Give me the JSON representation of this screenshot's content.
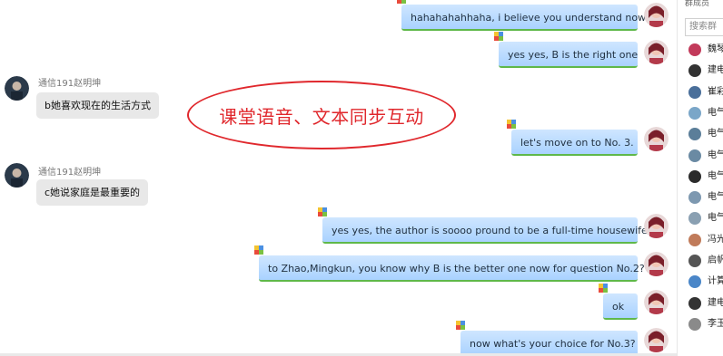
{
  "chat": {
    "annotation": "课堂语音、文本同步互动",
    "messages": [
      {
        "dir": "out",
        "text": "hahahahahhaha, i believe you understand now"
      },
      {
        "dir": "out",
        "text": "yes yes, B is the right one"
      },
      {
        "dir": "in",
        "sender": "通信191赵明坤",
        "text": "b她喜欢现在的生活方式"
      },
      {
        "dir": "out",
        "text": "let's move on to No. 3."
      },
      {
        "dir": "in",
        "sender": "通信191赵明坤",
        "text": "c她说家庭是最重要的"
      },
      {
        "dir": "out",
        "text": "yes yes, the author is soooo pround to be a full-time housewife"
      },
      {
        "dir": "out",
        "text": "to Zhao,Mingkun, you know why B is the better one now for question No.2?"
      },
      {
        "dir": "out",
        "text": "ok"
      },
      {
        "dir": "out",
        "text": "now what's your choice for No.3?"
      }
    ]
  },
  "sidebar": {
    "title": "群成员",
    "search_placeholder": "搜索群",
    "members": [
      {
        "name": "魏琴",
        "color": "#c23a5a"
      },
      {
        "name": "建电",
        "color": "#333333"
      },
      {
        "name": "崔彩",
        "color": "#4a6f9a"
      },
      {
        "name": "电气",
        "color": "#7aa6c8"
      },
      {
        "name": "电气",
        "color": "#5b7e99"
      },
      {
        "name": "电气",
        "color": "#6a8aa3"
      },
      {
        "name": "电气",
        "color": "#2b2b2b"
      },
      {
        "name": "电气",
        "color": "#7d98b0"
      },
      {
        "name": "电气",
        "color": "#8aa0b2"
      },
      {
        "name": "冯光",
        "color": "#c07b5a"
      },
      {
        "name": "启帆",
        "color": "#555555"
      },
      {
        "name": "计算",
        "color": "#4a86c8"
      },
      {
        "name": "建电",
        "color": "#333333"
      },
      {
        "name": "李玉",
        "color": "#8a8a8a"
      }
    ]
  }
}
